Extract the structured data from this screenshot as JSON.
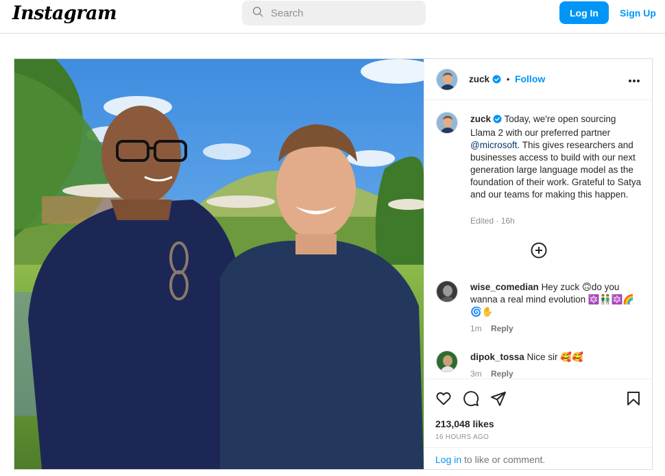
{
  "topbar": {
    "logo": "Instagram",
    "search_placeholder": "Search",
    "login_label": "Log In",
    "signup_label": "Sign Up"
  },
  "post": {
    "author": "zuck",
    "follow_label": "Follow",
    "caption": {
      "username": "zuck",
      "text_before": " Today, we're open sourcing Llama 2 with our preferred partner ",
      "mention": "@microsoft",
      "text_after": ". This gives researchers and businesses access to build with our next generation large language model as the foundation of their work. Grateful to Satya and our teams for making this happen.",
      "time": "Edited · 16h"
    },
    "comments": [
      {
        "username": "wise_comedian",
        "text": "Hey zuck 🙃do you wanna a real mind evolution 🔯👬🔯🌈🌀✋",
        "time": "1m",
        "reply": "Reply"
      },
      {
        "username": "dipok_tossa",
        "text": "Nice sir 🥰🥰",
        "time": "3m",
        "reply": "Reply"
      }
    ],
    "likes": "213,048 likes",
    "time_ago": "16 HOURS AGO",
    "login_prompt": {
      "link": "Log in",
      "rest": " to like or comment."
    }
  },
  "colors": {
    "accent": "#0095f6",
    "verified": "#0095f6",
    "border": "#dbdbdb"
  },
  "icons": [
    "search-icon",
    "verified-icon",
    "more-icon",
    "add-comments-icon",
    "heart-icon",
    "comment-icon",
    "share-icon",
    "bookmark-icon"
  ]
}
